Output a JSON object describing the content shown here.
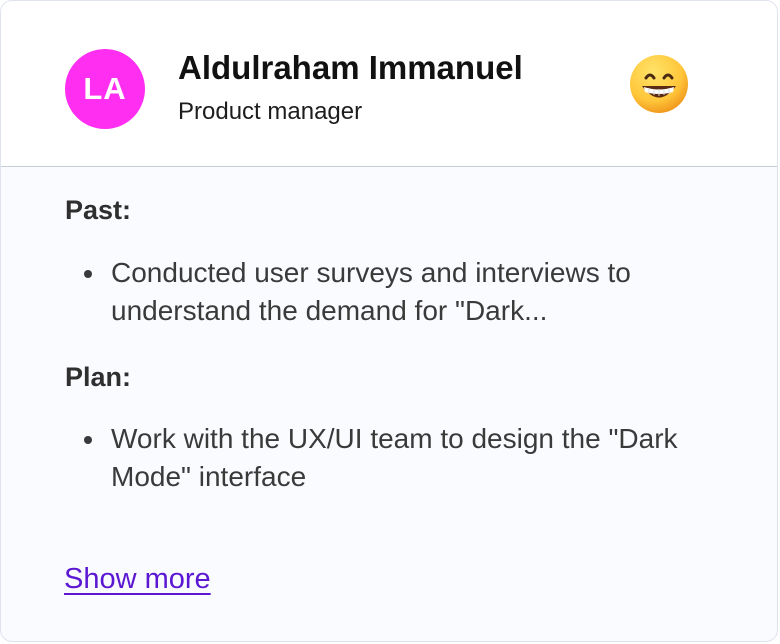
{
  "user": {
    "initials": "LA",
    "name": "Aldulraham Immanuel",
    "role": "Product manager",
    "avatar_color": "#ff2ef0",
    "emoji_icon": "grinning-face-icon"
  },
  "sections": {
    "past": {
      "title": "Past:",
      "items": [
        "Conducted user surveys and interviews to understand the demand for \"Dark..."
      ]
    },
    "plan": {
      "title": "Plan:",
      "items": [
        "Work with the UX/UI team to design the \"Dark Mode\" interface"
      ]
    }
  },
  "show_more_label": "Show more",
  "colors": {
    "link": "#5b17d1",
    "divider": "#c8ccd6"
  }
}
